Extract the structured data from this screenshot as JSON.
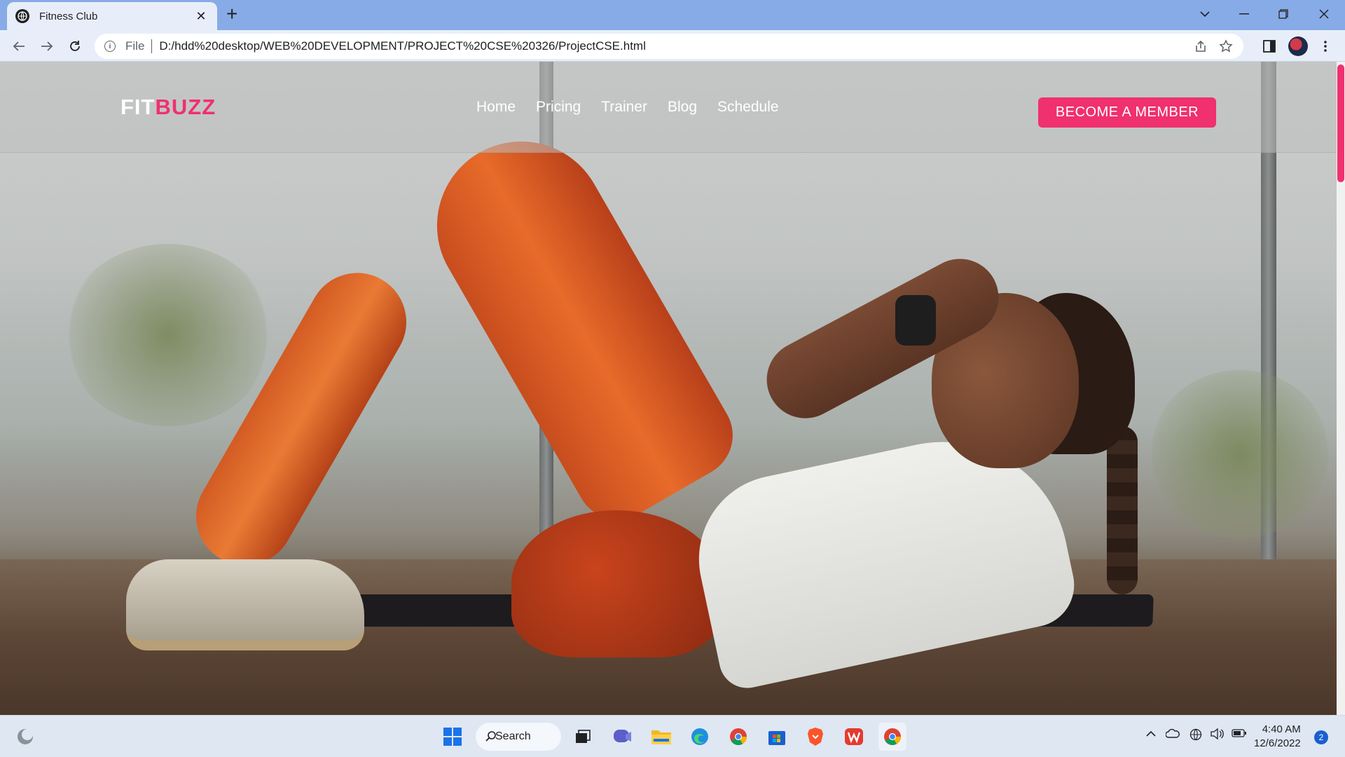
{
  "browser": {
    "tab_title": "Fitness Club",
    "tab_close": "✕",
    "new_tab": "+",
    "scheme_label": "File",
    "url": "D:/hdd%20desktop/WEB%20DEVELOPMENT/PROJECT%20CSE%20326/ProjectCSE.html"
  },
  "site": {
    "logo_part1": "FIT",
    "logo_part2": "BUZZ",
    "nav": [
      "Home",
      "Pricing",
      "Trainer",
      "Blog",
      "Schedule"
    ],
    "cta": "BECOME A MEMBER",
    "accent_color": "#f0306f"
  },
  "taskbar": {
    "search_label": "Search",
    "time": "4:40 AM",
    "date": "12/6/2022",
    "notification_count": "2"
  }
}
